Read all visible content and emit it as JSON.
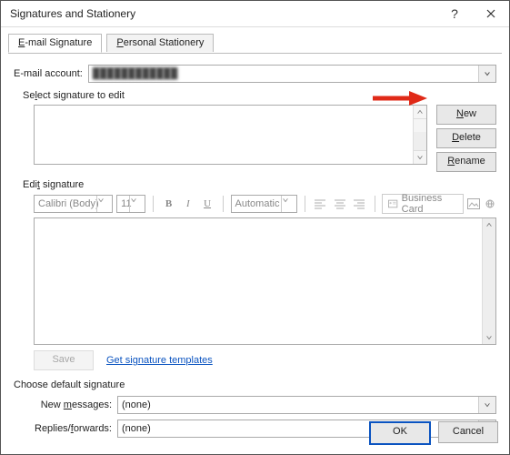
{
  "window": {
    "title": "Signatures and Stationery"
  },
  "tabs": {
    "email": "E-mail Signature",
    "stationery": "Personal Stationery"
  },
  "account": {
    "label": "E-mail account:",
    "value": "████████████"
  },
  "select_group": {
    "title": "Select signature to edit",
    "buttons": {
      "new": "New",
      "del": "Delete",
      "rename": "Rename"
    }
  },
  "edit_group": {
    "title": "Edit signature"
  },
  "toolbar": {
    "font": "Calibri (Body)",
    "size": "11",
    "color": "Automatic",
    "bizcard": "Business Card"
  },
  "save_row": {
    "save": "Save",
    "link": "Get signature templates"
  },
  "defaults": {
    "title": "Choose default signature",
    "new_label": "New messages:",
    "new_value": "(none)",
    "reply_label": "Replies/forwards:",
    "reply_value": "(none)"
  },
  "footer": {
    "ok": "OK",
    "cancel": "Cancel"
  }
}
